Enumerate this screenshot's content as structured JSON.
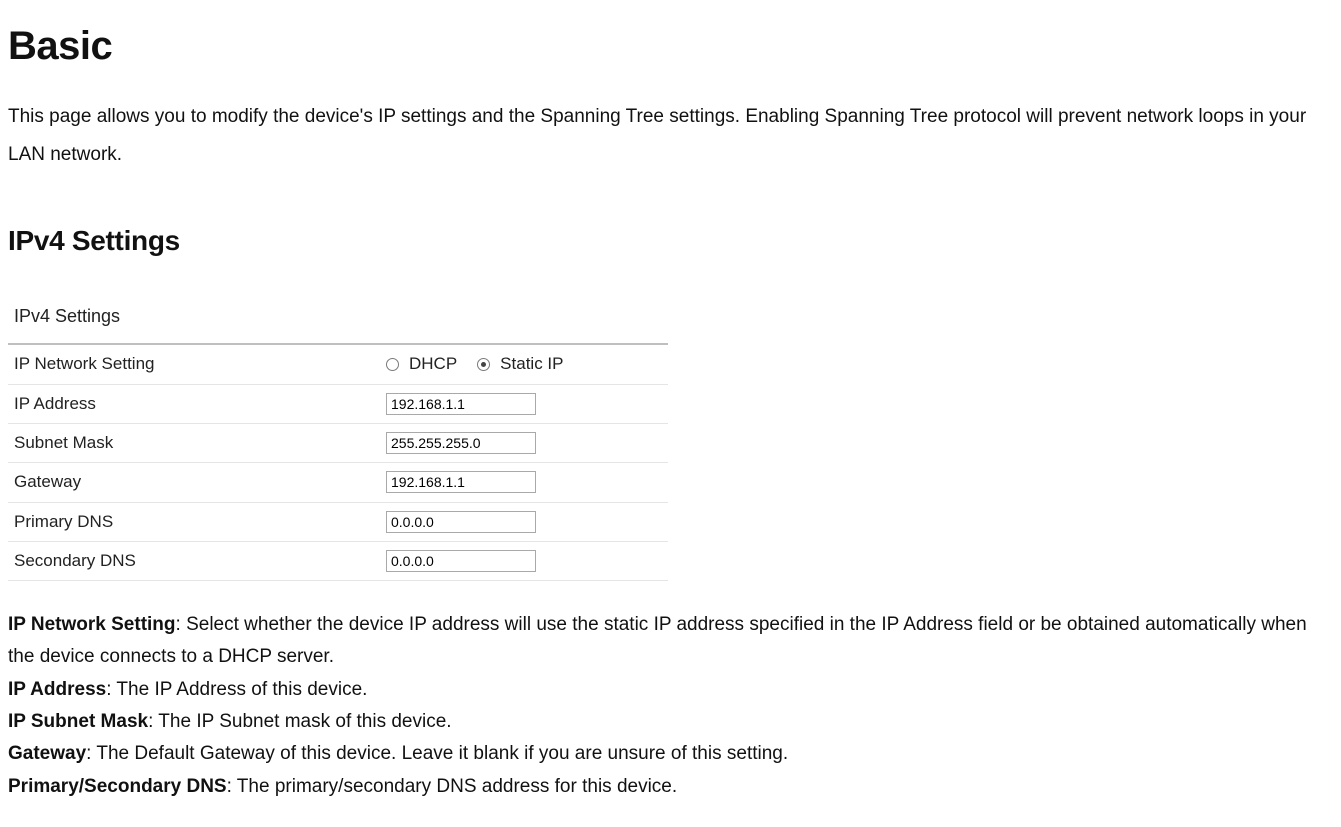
{
  "title": "Basic",
  "intro": "This page allows you to modify the device's IP settings and the Spanning Tree settings. Enabling Spanning Tree protocol will prevent network loops in your LAN network.",
  "section_heading": "IPv4 Settings",
  "panel": {
    "title": "IPv4 Settings",
    "rows": {
      "network_setting": {
        "label": "IP Network Setting",
        "option_dhcp": "DHCP",
        "option_static": "Static IP",
        "selected": "static"
      },
      "ip_address": {
        "label": "IP Address",
        "value": "192.168.1.1"
      },
      "subnet_mask": {
        "label": "Subnet Mask",
        "value": "255.255.255.0"
      },
      "gateway": {
        "label": "Gateway",
        "value": "192.168.1.1"
      },
      "primary_dns": {
        "label": "Primary DNS",
        "value": "0.0.0.0"
      },
      "secondary_dns": {
        "label": "Secondary DNS",
        "value": "0.0.0.0"
      }
    }
  },
  "definitions": {
    "ip_network_setting": {
      "term": "IP Network Setting",
      "text": ": Select whether the device IP address will use the static IP address specified in the IP Address field or be obtained automatically when the device connects to a DHCP server."
    },
    "ip_address": {
      "term": "IP Address",
      "text": ": The IP Address of this device."
    },
    "ip_subnet_mask": {
      "term": "IP Subnet Mask",
      "text": ": The IP Subnet mask of this device."
    },
    "gateway": {
      "term": "Gateway",
      "text": ": The Default Gateway of this device. Leave it blank if you are unsure of this setting."
    },
    "dns": {
      "term": "Primary/Secondary DNS",
      "text": ": The primary/secondary DNS address for this device."
    }
  }
}
